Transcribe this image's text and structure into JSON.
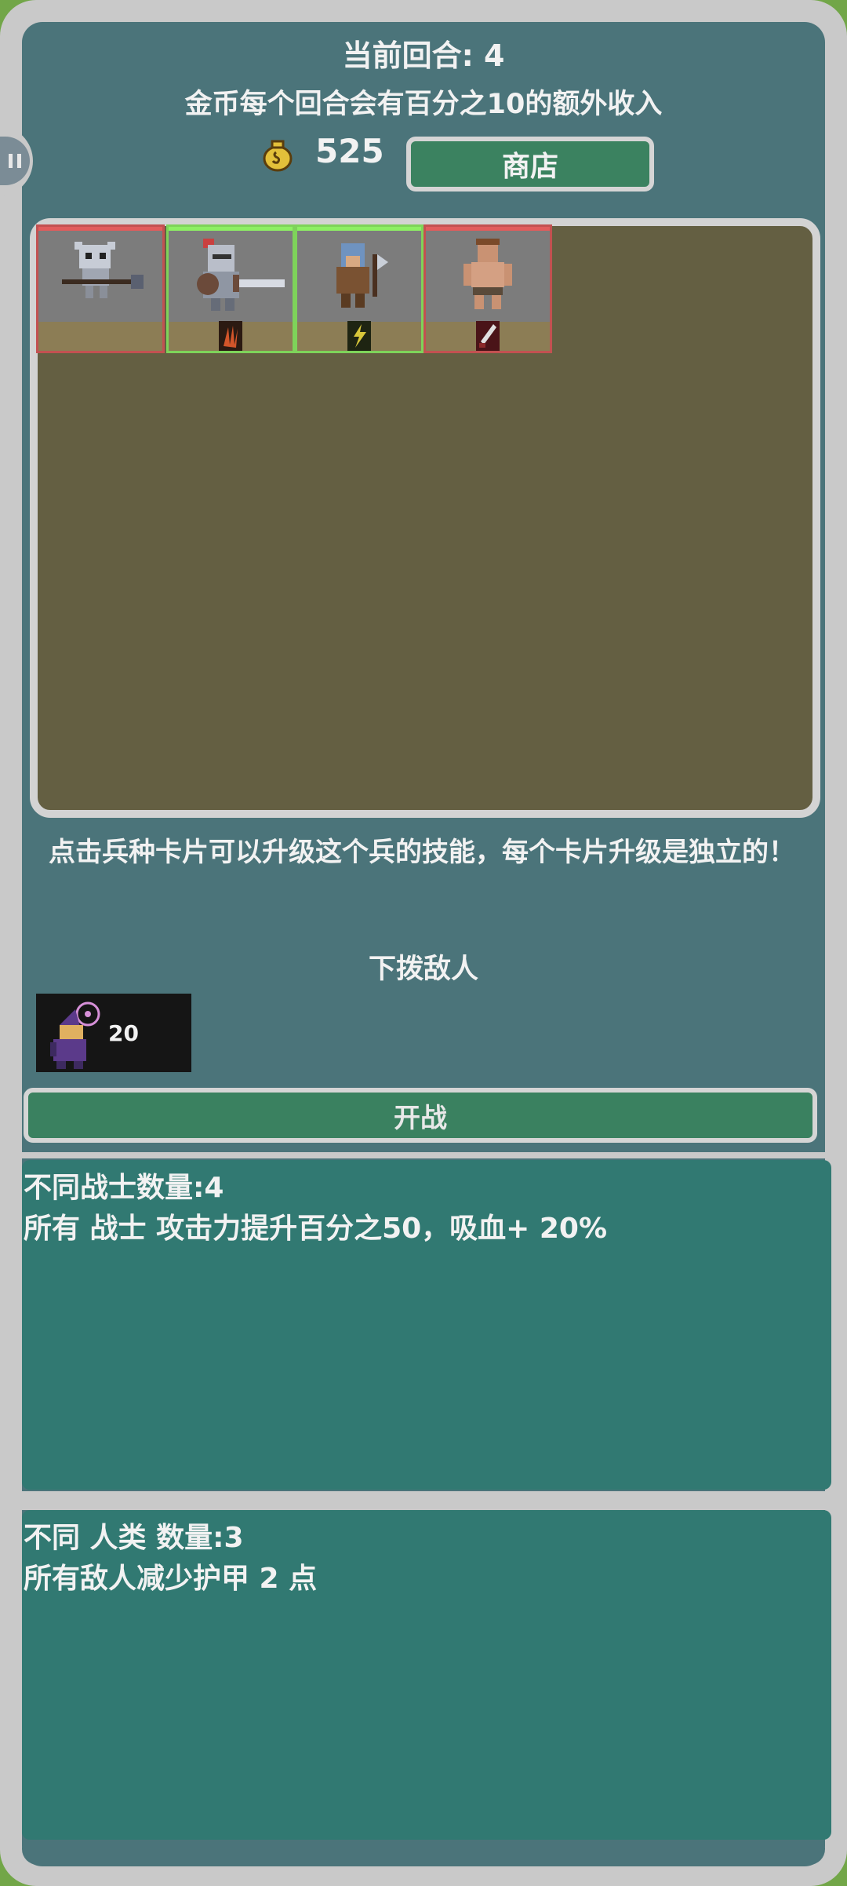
{
  "header": {
    "round_label": "当前回合: 4",
    "income_label": "金币每个回合会有百分之10的额外收入",
    "gold_amount": "525",
    "shop_label": "商店"
  },
  "side_tab": {
    "icon": "pause-icon"
  },
  "board": {
    "units": [
      {
        "name": "horned-skeleton-lancer",
        "state": "red"
      },
      {
        "name": "armored-knight",
        "state": "green",
        "skill_icon": "fire-claw-icon"
      },
      {
        "name": "helmeted-axe-warrior",
        "state": "green",
        "skill_icon": "lightning-icon"
      },
      {
        "name": "bare-chested-barbarian",
        "state": "red",
        "skill_icon": "blade-icon"
      }
    ]
  },
  "hint_text": "点击兵种卡片可以升级这个兵的技能，每个卡片升级是独立的！",
  "enemy": {
    "section_title": "下拨敌人",
    "count": "20",
    "icon": "purple-mage-icon"
  },
  "fight_label": "开战",
  "synergies": [
    {
      "title": "不同战士数量:4",
      "desc": "所有 战士 攻击力提升百分之50，吸血+ 20%"
    },
    {
      "title": "不同 人类 数量:3",
      "desc": "所有敌人减少护甲 2 点"
    }
  ],
  "colors": {
    "panel": "#4b747a",
    "board": "#645f42",
    "button": "#3b8260",
    "synergy_panel": "#317972",
    "card_red": "#c25151",
    "card_green": "#7ed35a"
  }
}
